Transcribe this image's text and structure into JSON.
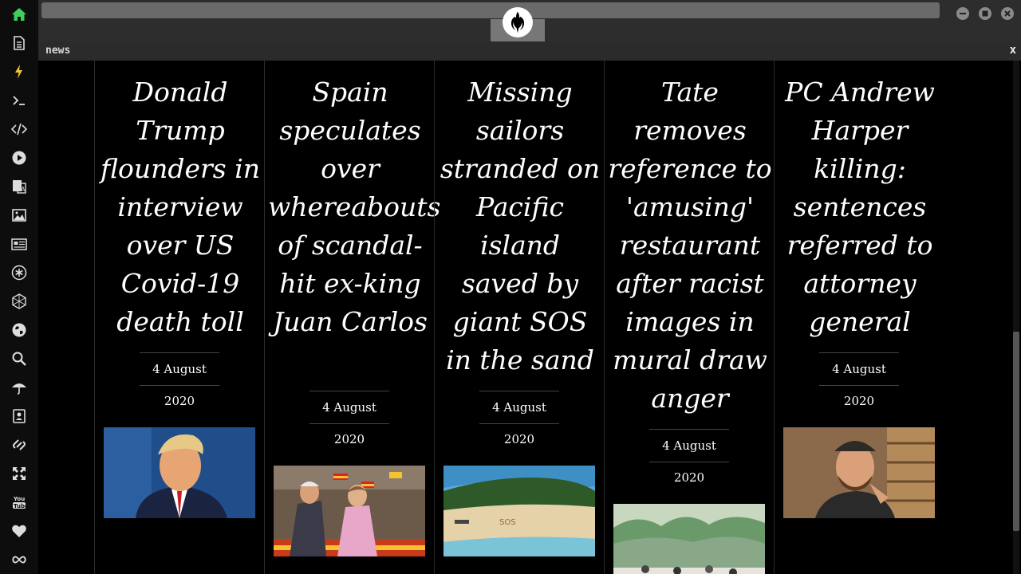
{
  "sidebar": {
    "items": [
      {
        "name": "home-icon"
      },
      {
        "name": "document-icon"
      },
      {
        "name": "lightning-icon"
      },
      {
        "name": "terminal-icon"
      },
      {
        "name": "code-icon"
      },
      {
        "name": "play-icon"
      },
      {
        "name": "translate-icon"
      },
      {
        "name": "image-icon"
      },
      {
        "name": "news-icon"
      },
      {
        "name": "asterisk-icon"
      },
      {
        "name": "network-icon"
      },
      {
        "name": "globe-icon"
      },
      {
        "name": "search-icon"
      },
      {
        "name": "umbrella-icon"
      },
      {
        "name": "contact-icon"
      },
      {
        "name": "link-icon"
      },
      {
        "name": "expand-icon"
      },
      {
        "name": "youtube-icon"
      },
      {
        "name": "heart-icon"
      },
      {
        "name": "infinity-icon"
      }
    ],
    "active_color": "#3ecf5a",
    "active_icon": "home-icon",
    "highlight_color": "#f4c430"
  },
  "window": {
    "tab_label": "news",
    "close_label": "x",
    "logo": "rebel-alliance-icon"
  },
  "articles": [
    {
      "title": "Donald Trump flounders in interview over US Covid-19 death toll",
      "date": "4 August 2020",
      "image": "donald-trump-photo"
    },
    {
      "title": "Spain speculates over whereabouts of scandal-hit ex-king Juan Carlos",
      "date": "4 August 2020",
      "image": "juan-carlos-photo"
    },
    {
      "title": "Missing sailors stranded on Pacific island saved by giant SOS in the sand",
      "date": "4 August 2020",
      "image": "island-sos-photo"
    },
    {
      "title": "Tate removes reference to 'amusing' restaurant after racist images in mural draw anger",
      "date": "4 August 2020",
      "image": "tate-mural-photo"
    },
    {
      "title": "PC Andrew Harper killing: sentences referred to attorney general",
      "date": "4 August 2020",
      "image": "andrew-harper-photo"
    }
  ]
}
